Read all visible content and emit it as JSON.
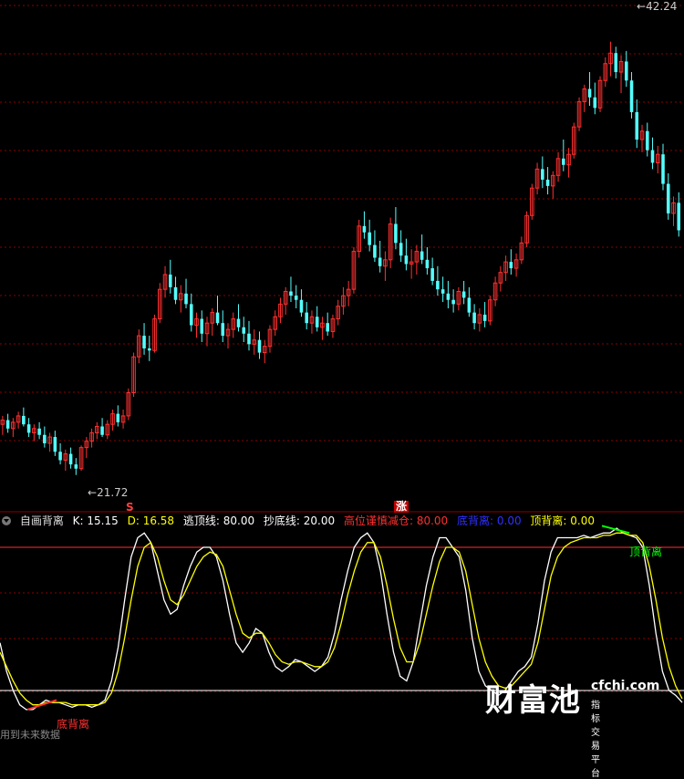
{
  "colors": {
    "background": "#000000",
    "grid": "#8b0000",
    "up_candle": "#ff3030",
    "down_candle": "#54ffff",
    "k_line": "#ffffff",
    "d_line": "#ffff00",
    "threshold_line": "#ff3030",
    "bottom_line": "#ffffff",
    "bottom_divergence": "#ff3030",
    "top_divergence": "#00ff00"
  },
  "price_panel": {
    "high_label": "42.24",
    "low_label": "21.72",
    "flag_sell": "S",
    "flag_rise": "涨"
  },
  "indicator_bar": {
    "name": "自画背离",
    "k_label": "K: 15.15",
    "d_label": "D: 16.58",
    "top_line_label": "逃顶线: 80.00",
    "bottom_line_label": "抄底线: 20.00",
    "caution_label": "高位谨慎减仓: 80.00",
    "bottom_div_label": "底背离: 0.00",
    "top_div_label": "顶背离: 0.00"
  },
  "annotations": {
    "bottom_divergence": "底背离",
    "top_divergence": "顶背离"
  },
  "watermark": {
    "main": "财富池",
    "url": "cfchi.com",
    "sub": "指标交易平台"
  },
  "footer_text": "用到未来数据",
  "chart_data": [
    {
      "type": "candlestick",
      "title": "",
      "ylim": [
        20,
        44
      ],
      "max_label": 42.24,
      "min_label": 21.72,
      "ohlc": [
        [
          24.1,
          24.5,
          23.6,
          24.3
        ],
        [
          24.3,
          24.6,
          23.7,
          23.9
        ],
        [
          23.9,
          24.4,
          23.5,
          24.2
        ],
        [
          24.2,
          24.7,
          23.9,
          24.5
        ],
        [
          24.5,
          24.9,
          24.0,
          24.1
        ],
        [
          24.1,
          24.4,
          23.5,
          23.7
        ],
        [
          23.7,
          24.1,
          23.3,
          23.9
        ],
        [
          23.9,
          24.2,
          23.4,
          23.6
        ],
        [
          23.6,
          24.0,
          23.0,
          23.2
        ],
        [
          23.2,
          23.7,
          22.8,
          23.5
        ],
        [
          23.5,
          23.8,
          22.6,
          22.8
        ],
        [
          22.8,
          23.2,
          22.2,
          22.4
        ],
        [
          22.4,
          22.9,
          21.9,
          22.7
        ],
        [
          22.7,
          23.0,
          22.0,
          22.2
        ],
        [
          22.2,
          22.5,
          21.7,
          22.0
        ],
        [
          22.0,
          23.1,
          21.9,
          23.0
        ],
        [
          23.0,
          23.5,
          22.5,
          23.3
        ],
        [
          23.3,
          23.9,
          23.0,
          23.7
        ],
        [
          23.7,
          24.2,
          23.4,
          24.0
        ],
        [
          24.0,
          24.4,
          23.5,
          23.6
        ],
        [
          23.6,
          24.3,
          23.4,
          24.1
        ],
        [
          24.1,
          24.8,
          23.8,
          24.6
        ],
        [
          24.6,
          25.0,
          24.0,
          24.2
        ],
        [
          24.2,
          24.8,
          23.9,
          24.5
        ],
        [
          24.5,
          25.8,
          24.3,
          25.6
        ],
        [
          25.6,
          27.5,
          25.4,
          27.3
        ],
        [
          27.3,
          28.6,
          27.0,
          28.3
        ],
        [
          28.3,
          28.9,
          27.4,
          27.7
        ],
        [
          27.7,
          28.3,
          27.1,
          27.6
        ],
        [
          27.6,
          29.3,
          27.5,
          29.1
        ],
        [
          29.1,
          30.8,
          28.9,
          30.5
        ],
        [
          30.5,
          31.6,
          30.1,
          31.2
        ],
        [
          31.2,
          31.9,
          30.3,
          30.6
        ],
        [
          30.6,
          31.1,
          29.8,
          30.0
        ],
        [
          30.0,
          30.7,
          29.4,
          30.3
        ],
        [
          30.3,
          31.0,
          29.6,
          29.8
        ],
        [
          29.8,
          30.3,
          28.5,
          28.8
        ],
        [
          28.8,
          29.4,
          28.2,
          29.1
        ],
        [
          29.1,
          29.5,
          28.0,
          28.4
        ],
        [
          28.4,
          29.2,
          27.8,
          28.9
        ],
        [
          28.9,
          29.6,
          28.3,
          29.4
        ],
        [
          29.4,
          30.2,
          28.8,
          28.9
        ],
        [
          28.9,
          29.5,
          28.0,
          28.3
        ],
        [
          28.3,
          28.9,
          27.7,
          28.6
        ],
        [
          28.6,
          29.4,
          28.2,
          29.1
        ],
        [
          29.1,
          29.8,
          28.5,
          28.7
        ],
        [
          28.7,
          29.2,
          28.0,
          28.4
        ],
        [
          28.4,
          29.0,
          27.6,
          27.9
        ],
        [
          27.9,
          28.6,
          27.4,
          28.1
        ],
        [
          28.1,
          28.5,
          27.2,
          27.5
        ],
        [
          27.5,
          28.1,
          27.0,
          27.8
        ],
        [
          27.8,
          28.8,
          27.5,
          28.6
        ],
        [
          28.6,
          29.5,
          28.3,
          29.2
        ],
        [
          29.2,
          30.1,
          28.9,
          29.8
        ],
        [
          29.8,
          30.6,
          29.3,
          30.4
        ],
        [
          30.4,
          31.1,
          29.9,
          30.2
        ],
        [
          30.2,
          30.7,
          29.6,
          30.0
        ],
        [
          30.0,
          30.5,
          29.2,
          29.4
        ],
        [
          29.4,
          29.9,
          28.6,
          28.9
        ],
        [
          28.9,
          29.5,
          28.4,
          29.2
        ],
        [
          29.2,
          29.7,
          28.5,
          28.7
        ],
        [
          28.7,
          29.2,
          28.1,
          28.9
        ],
        [
          28.9,
          29.4,
          28.3,
          28.5
        ],
        [
          28.5,
          29.3,
          28.2,
          29.1
        ],
        [
          29.1,
          30.0,
          28.8,
          29.7
        ],
        [
          29.7,
          30.6,
          29.3,
          30.2
        ],
        [
          30.2,
          30.9,
          29.7,
          30.5
        ],
        [
          30.5,
          32.5,
          30.3,
          32.3
        ],
        [
          32.3,
          33.8,
          32.0,
          33.5
        ],
        [
          33.5,
          34.2,
          32.9,
          33.2
        ],
        [
          33.2,
          33.8,
          32.3,
          32.6
        ],
        [
          32.6,
          33.3,
          31.8,
          32.0
        ],
        [
          32.0,
          32.8,
          31.3,
          31.6
        ],
        [
          31.6,
          32.3,
          30.9,
          31.9
        ],
        [
          31.9,
          33.9,
          31.5,
          33.6
        ],
        [
          33.6,
          34.4,
          32.4,
          32.7
        ],
        [
          32.7,
          33.3,
          31.8,
          32.1
        ],
        [
          32.1,
          32.9,
          31.4,
          31.7
        ],
        [
          31.7,
          32.4,
          31.0,
          31.8
        ],
        [
          31.8,
          32.6,
          31.2,
          32.3
        ],
        [
          32.3,
          33.1,
          31.7,
          31.9
        ],
        [
          31.9,
          32.5,
          31.2,
          31.5
        ],
        [
          31.5,
          32.0,
          30.7,
          30.9
        ],
        [
          30.9,
          31.6,
          30.2,
          30.5
        ],
        [
          30.5,
          31.1,
          29.9,
          30.3
        ],
        [
          30.3,
          30.9,
          29.6,
          30.0
        ],
        [
          30.0,
          30.5,
          29.4,
          29.8
        ],
        [
          29.8,
          30.6,
          29.5,
          30.4
        ],
        [
          30.4,
          30.9,
          29.8,
          30.1
        ],
        [
          30.1,
          30.6,
          29.2,
          29.4
        ],
        [
          29.4,
          29.8,
          28.6,
          28.9
        ],
        [
          28.9,
          29.6,
          28.5,
          29.3
        ],
        [
          29.3,
          29.9,
          28.7,
          29.0
        ],
        [
          29.0,
          30.2,
          28.8,
          30.0
        ],
        [
          30.0,
          31.1,
          29.7,
          30.8
        ],
        [
          30.8,
          31.6,
          30.4,
          31.3
        ],
        [
          31.3,
          32.1,
          30.9,
          31.8
        ],
        [
          31.8,
          32.4,
          31.2,
          31.5
        ],
        [
          31.5,
          32.2,
          31.1,
          31.9
        ],
        [
          31.9,
          33.0,
          31.7,
          32.7
        ],
        [
          32.7,
          34.2,
          32.5,
          34.0
        ],
        [
          34.0,
          35.5,
          33.8,
          35.3
        ],
        [
          35.3,
          36.5,
          35.0,
          36.2
        ],
        [
          36.2,
          36.8,
          35.3,
          35.7
        ],
        [
          35.7,
          36.3,
          35.0,
          35.4
        ],
        [
          35.4,
          36.1,
          34.8,
          35.9
        ],
        [
          35.9,
          37.0,
          35.6,
          36.7
        ],
        [
          36.7,
          37.6,
          36.1,
          36.4
        ],
        [
          36.4,
          37.2,
          35.8,
          36.9
        ],
        [
          36.9,
          38.4,
          36.7,
          38.2
        ],
        [
          38.2,
          39.6,
          38.0,
          39.4
        ],
        [
          39.4,
          40.2,
          38.9,
          40.0
        ],
        [
          40.0,
          40.8,
          39.2,
          39.6
        ],
        [
          39.6,
          40.3,
          38.8,
          39.1
        ],
        [
          39.1,
          40.6,
          38.9,
          40.4
        ],
        [
          40.4,
          41.5,
          40.1,
          41.2
        ],
        [
          41.2,
          42.24,
          40.6,
          41.7
        ],
        [
          41.7,
          42.0,
          40.5,
          40.8
        ],
        [
          40.8,
          41.6,
          39.8,
          41.3
        ],
        [
          41.3,
          41.8,
          40.1,
          40.4
        ],
        [
          40.4,
          40.8,
          38.6,
          38.9
        ],
        [
          38.9,
          39.5,
          37.2,
          37.6
        ],
        [
          37.6,
          38.3,
          37.0,
          38.0
        ],
        [
          38.0,
          38.4,
          36.8,
          37.1
        ],
        [
          37.1,
          37.7,
          36.2,
          36.5
        ],
        [
          36.5,
          37.3,
          36.0,
          36.9
        ],
        [
          36.9,
          37.4,
          35.2,
          35.5
        ],
        [
          35.5,
          36.0,
          33.8,
          34.1
        ],
        [
          34.1,
          34.9,
          33.5,
          34.6
        ],
        [
          34.6,
          35.1,
          33.0,
          33.3
        ]
      ]
    },
    {
      "type": "line",
      "title": "自画背离",
      "ylim": [
        0,
        100
      ],
      "hlines": [
        {
          "name": "逃顶线",
          "value": 80
        },
        {
          "name": "抄底线",
          "value": 20
        }
      ],
      "series": [
        {
          "name": "K",
          "values": [
            40,
            28,
            20,
            14,
            12,
            12,
            14,
            16,
            15,
            15,
            14,
            13,
            14,
            14,
            13,
            14,
            16,
            24,
            38,
            58,
            76,
            84,
            86,
            82,
            70,
            58,
            52,
            54,
            64,
            72,
            78,
            80,
            80,
            76,
            66,
            52,
            40,
            36,
            40,
            46,
            44,
            36,
            30,
            28,
            30,
            33,
            32,
            30,
            28,
            30,
            34,
            44,
            58,
            70,
            80,
            84,
            86,
            82,
            70,
            52,
            36,
            26,
            24,
            32,
            48,
            64,
            76,
            84,
            84,
            80,
            76,
            62,
            42,
            28,
            22,
            20,
            18,
            20,
            24,
            28,
            30,
            34,
            48,
            66,
            78,
            84,
            84,
            84,
            84,
            85,
            84,
            85,
            86,
            86,
            88,
            86,
            85,
            84,
            80,
            64,
            44,
            28,
            20,
            18,
            15
          ]
        },
        {
          "name": "D",
          "values": [
            36,
            30,
            24,
            19,
            16,
            14,
            14,
            15,
            15,
            15,
            15,
            14,
            14,
            14,
            14,
            14,
            15,
            19,
            28,
            42,
            58,
            72,
            80,
            82,
            76,
            66,
            58,
            56,
            60,
            66,
            72,
            76,
            78,
            77,
            72,
            62,
            52,
            44,
            42,
            44,
            44,
            40,
            35,
            32,
            31,
            32,
            32,
            31,
            30,
            30,
            32,
            38,
            48,
            60,
            70,
            78,
            82,
            82,
            76,
            64,
            50,
            38,
            32,
            32,
            40,
            52,
            64,
            74,
            80,
            80,
            78,
            70,
            56,
            42,
            32,
            26,
            22,
            21,
            22,
            25,
            28,
            31,
            40,
            54,
            68,
            76,
            80,
            82,
            83,
            84,
            84,
            84,
            85,
            85,
            86,
            86,
            85,
            85,
            82,
            72,
            58,
            42,
            30,
            22,
            16.58
          ]
        }
      ]
    }
  ]
}
